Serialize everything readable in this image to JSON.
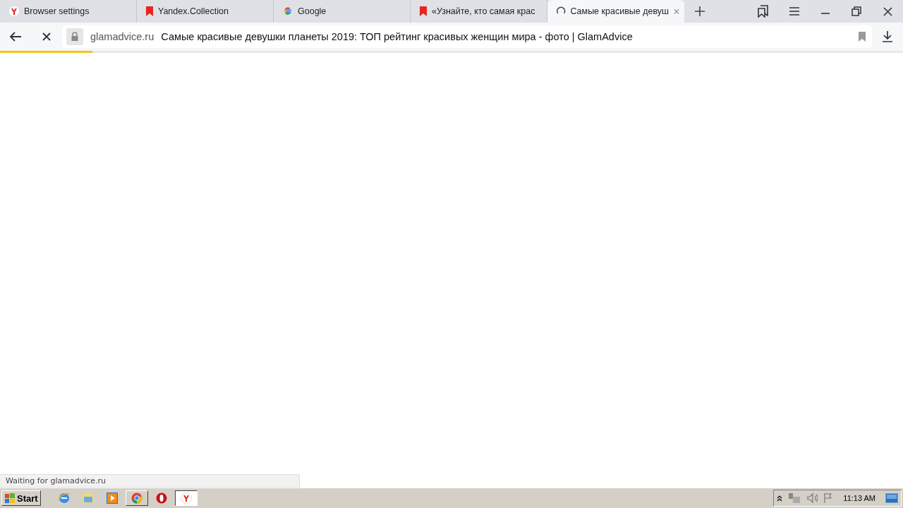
{
  "tabs": [
    {
      "title": "Browser settings",
      "kind": "yandex",
      "selected": false
    },
    {
      "title": "Yandex.Collection",
      "kind": "bookmark",
      "selected": false
    },
    {
      "title": "Google",
      "kind": "google",
      "selected": false
    },
    {
      "title": "«Узнайте, кто самая крас",
      "kind": "bookmark",
      "selected": false
    },
    {
      "title": "Самые красивые девуш",
      "kind": "loading",
      "selected": true
    }
  ],
  "address_bar": {
    "domain": "glamadvice.ru",
    "page_title": "Самые красивые девушки планеты 2019: ТОП рейтинг красивых женщин мира - фото | GlamAdvice"
  },
  "load_progress": {
    "level": 0.102
  },
  "status_bubble": "Waiting for glamadvice.ru",
  "taskbar": {
    "start": "Start",
    "items": [
      {
        "kind": "ie",
        "selected": false
      },
      {
        "kind": "explorer",
        "selected": false
      },
      {
        "kind": "media",
        "selected": false
      },
      {
        "kind": "chrome",
        "selected": false
      },
      {
        "kind": "opera",
        "selected": false
      },
      {
        "kind": "yandex",
        "selected": true
      }
    ],
    "clock": "11:13 AM"
  }
}
